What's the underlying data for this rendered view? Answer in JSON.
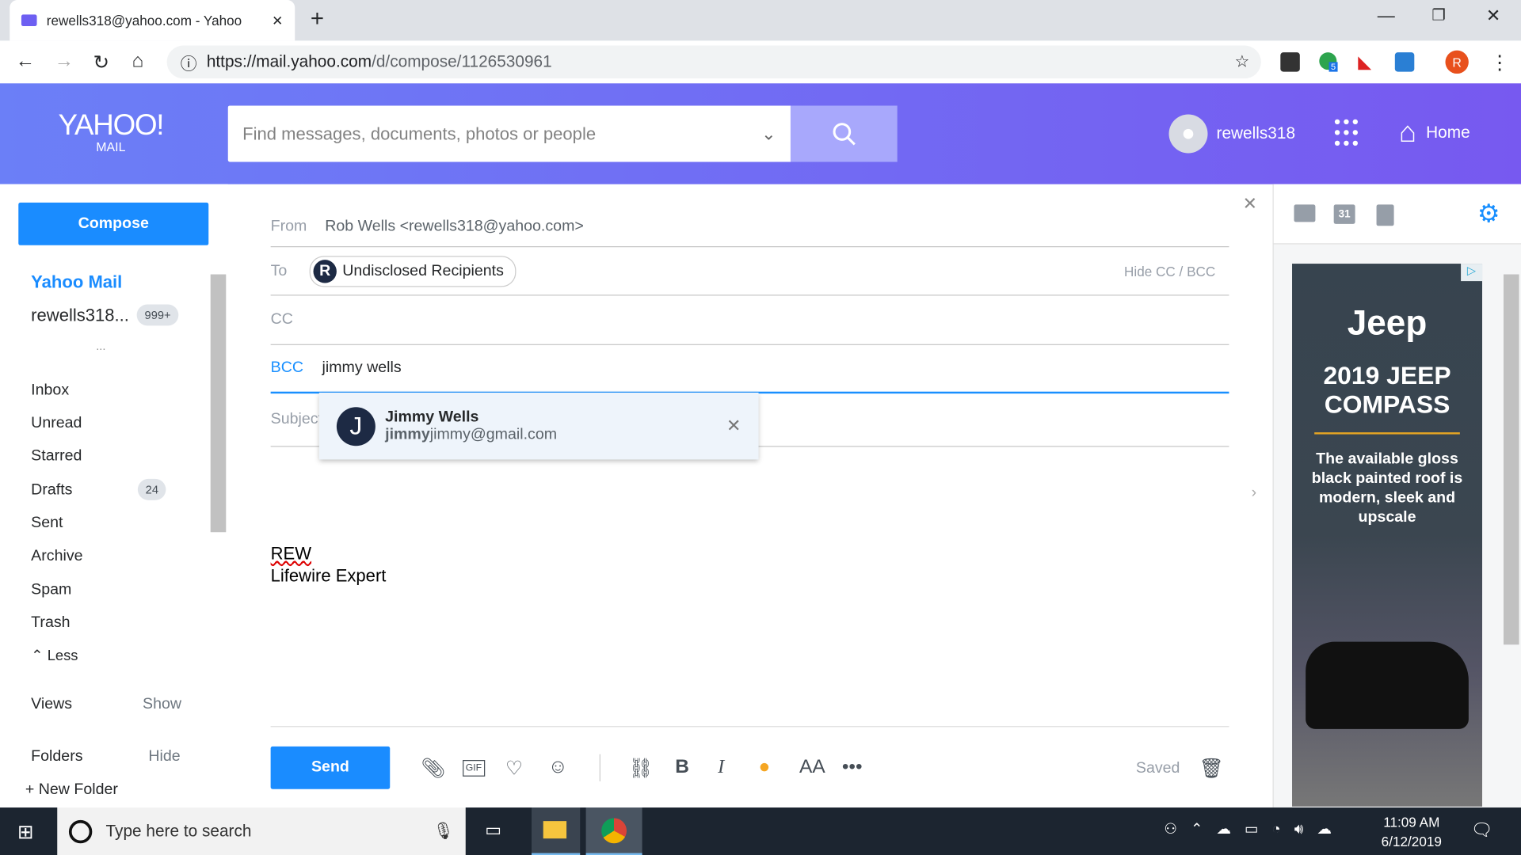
{
  "browser": {
    "tab_title": "rewells318@yahoo.com - Yahoo",
    "url_host": "https://mail.yahoo.com",
    "url_path": "/d/compose/1126530961",
    "ext_badge": "5",
    "profile": "R"
  },
  "header": {
    "logo": "YAHOO!",
    "logo_sub": "MAIL",
    "search_placeholder": "Find messages, documents, photos or people",
    "username": "rewells318",
    "home": "Home"
  },
  "sidebar": {
    "compose": "Compose",
    "account_title": "Yahoo Mail",
    "account": "rewells318...",
    "account_badge": "999+",
    "more": "...",
    "folders": [
      {
        "label": "Inbox"
      },
      {
        "label": "Unread"
      },
      {
        "label": "Starred"
      },
      {
        "label": "Drafts",
        "count": "24"
      },
      {
        "label": "Sent"
      },
      {
        "label": "Archive"
      },
      {
        "label": "Spam"
      },
      {
        "label": "Trash"
      }
    ],
    "less": "Less",
    "views": "Views",
    "views_action": "Show",
    "folders_label": "Folders",
    "folders_action": "Hide",
    "new_folder": "+ New Folder"
  },
  "compose": {
    "from_label": "From",
    "from_value": "Rob Wells <rewells318@yahoo.com>",
    "to_label": "To",
    "to_chip": "Undisclosed Recipients",
    "to_chip_initial": "R",
    "hide_ccbcc": "Hide CC / BCC",
    "cc_label": "CC",
    "bcc_label": "BCC",
    "bcc_value": "jimmy wells",
    "subject_label": "Subject",
    "suggestion": {
      "initial": "J",
      "name": "Jimmy Wells",
      "email_match": "jimmy",
      "email_rest": "jimmy@gmail.com"
    },
    "body_lines": [
      "REW",
      "Lifewire Expert"
    ],
    "send": "Send",
    "saved": "Saved"
  },
  "ad": {
    "brand": "Jeep",
    "headline": "2019 JEEP COMPASS",
    "text": "The available gloss black painted roof is modern, sleek and upscale"
  },
  "rightpanel": {
    "calendar_day": "31"
  },
  "taskbar": {
    "search_placeholder": "Type here to search",
    "time": "11:09 AM",
    "date": "6/12/2019"
  }
}
